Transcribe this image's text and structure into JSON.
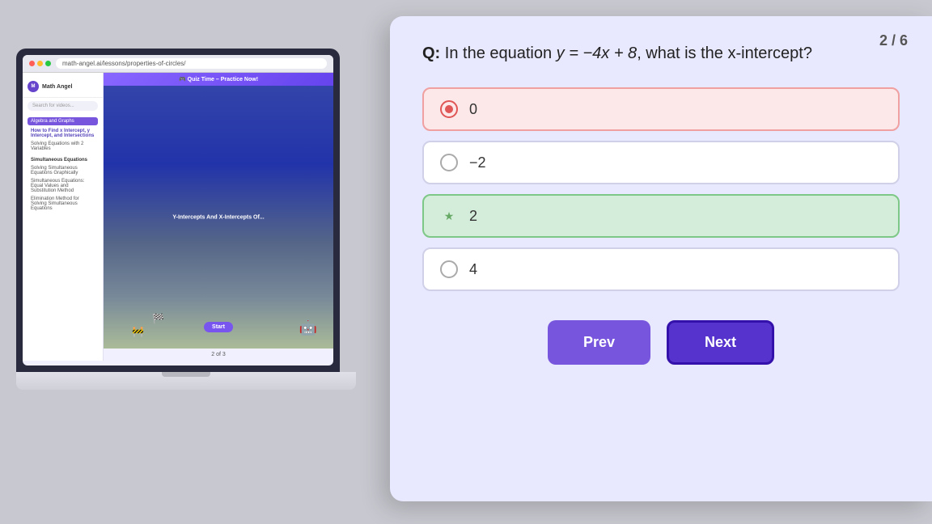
{
  "laptop": {
    "url": "math-angel.ai/lessons/properties-of-circles/",
    "logo": "Math Angel",
    "search_placeholder": "Search for videos...",
    "sidebar": {
      "section_title": "Algebra and Graphs",
      "items": [
        {
          "label": "How to Find x Intercept, y Intercept, and Intersections",
          "active": true
        },
        {
          "label": "Solving Equations with 2 Variables",
          "active": false
        },
        {
          "label": "Simultaneous Equations",
          "type": "header"
        },
        {
          "label": "Solving Simultaneous Equations Graphically",
          "active": false
        },
        {
          "label": "Simultaneous Equations: Equal Values and Substitution Method",
          "active": false
        },
        {
          "label": "Elimination Method for Solving Simultaneous Equations",
          "active": false
        }
      ]
    },
    "quiz_banner": "🎮 Quiz Time – Practice Now!",
    "video_title": "Y-Intercepts And X-Intercepts Of...",
    "start_button": "Start",
    "pagination": "2 of 3"
  },
  "quiz": {
    "counter": "2 / 6",
    "question": "Q: In the equation y = −4x + 8, what is the x-intercept?",
    "answers": [
      {
        "label": "0",
        "state": "incorrect"
      },
      {
        "label": "−2",
        "state": "default"
      },
      {
        "label": "2",
        "state": "correct"
      },
      {
        "label": "4",
        "state": "default"
      }
    ],
    "prev_button": "Prev",
    "next_button": "Next",
    "bg_prev_button": "Prev"
  }
}
